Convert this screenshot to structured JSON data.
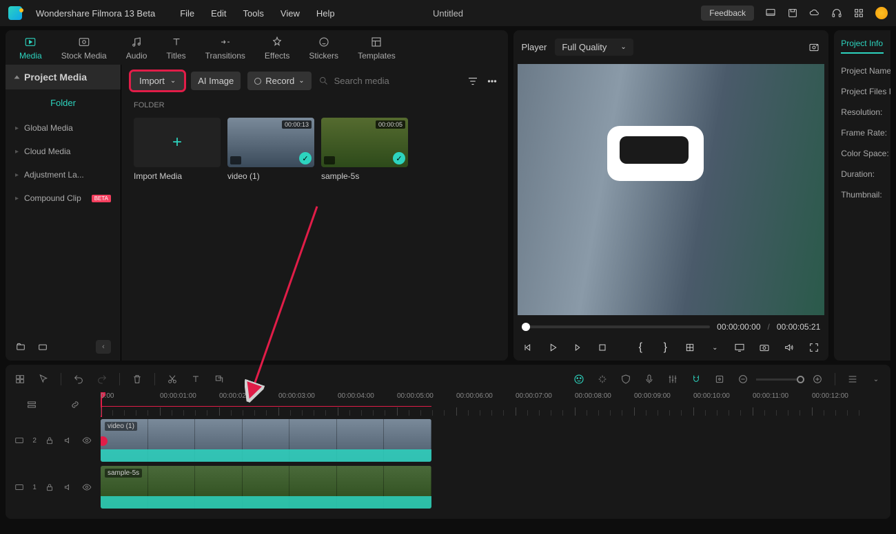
{
  "title": {
    "app": "Wondershare Filmora 13 Beta",
    "document": "Untitled"
  },
  "menus": [
    "File",
    "Edit",
    "Tools",
    "View",
    "Help"
  ],
  "titlebar": {
    "feedback": "Feedback"
  },
  "tabs": [
    {
      "label": "Media",
      "active": true
    },
    {
      "label": "Stock Media"
    },
    {
      "label": "Audio"
    },
    {
      "label": "Titles"
    },
    {
      "label": "Transitions"
    },
    {
      "label": "Effects"
    },
    {
      "label": "Stickers"
    },
    {
      "label": "Templates"
    }
  ],
  "sidebar": {
    "project_media": "Project Media",
    "folder": "Folder",
    "items": [
      {
        "label": "Global Media"
      },
      {
        "label": "Cloud Media"
      },
      {
        "label": "Adjustment La..."
      },
      {
        "label": "Compound Clip",
        "beta": "BETA"
      }
    ]
  },
  "toolbar": {
    "import": "Import",
    "ai_image": "AI Image",
    "record": "Record",
    "search_ph": "Search media"
  },
  "folder": {
    "label": "FOLDER",
    "items": [
      {
        "title": "Import Media",
        "kind": "import"
      },
      {
        "title": "video (1)",
        "dur": "00:00:13"
      },
      {
        "title": "sample-5s",
        "dur": "00:00:05"
      }
    ]
  },
  "preview": {
    "player": "Player",
    "quality": "Full Quality",
    "current": "00:00:00:00",
    "total": "00:00:05:21"
  },
  "info": {
    "title": "Project Info",
    "rows": [
      "Project Name",
      "Project Files I",
      "Resolution:",
      "Frame Rate:",
      "Color Space:",
      "Duration:",
      "Thumbnail:"
    ]
  },
  "timeline": {
    "marks": [
      "0:00",
      "00:00:01:00",
      "00:00:02:00",
      "00:00:03:00",
      "00:00:04:00",
      "00:00:05:00",
      "00:00:06:00",
      "00:00:07:00",
      "00:00:08:00",
      "00:00:09:00",
      "00:00:10:00",
      "00:00:11:00",
      "00:00:12:00"
    ],
    "tracks": [
      {
        "id": 2,
        "clip": "video (1)"
      },
      {
        "id": 1,
        "clip": "sample-5s"
      }
    ]
  }
}
